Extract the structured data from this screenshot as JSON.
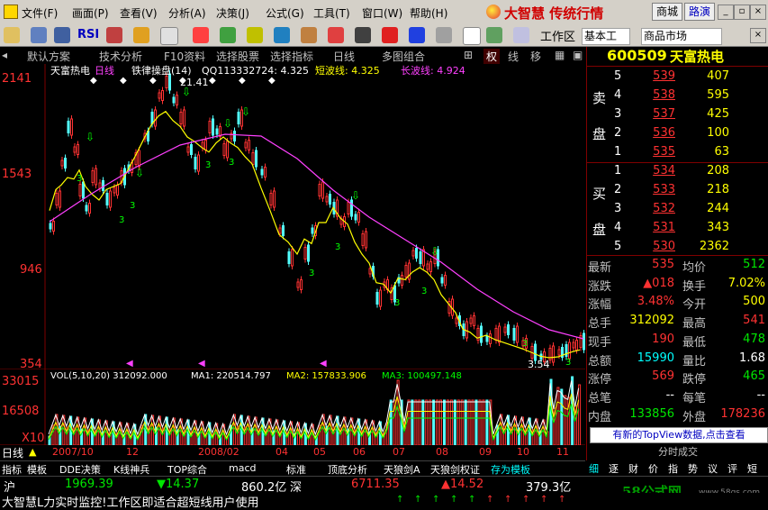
{
  "menu": {
    "items": [
      "文件(F)",
      "画面(P)",
      "查看(V)",
      "分析(A)",
      "决策(J)",
      "公式(G)",
      "工具(T)",
      "窗口(W)",
      "帮助(H)"
    ],
    "brand": "大智慧 传统行情",
    "btn_market": "商城",
    "btn_road": "路演"
  },
  "toolbar": {
    "rsi": "RSI",
    "workspace": "工作区",
    "basic": "基本工",
    "market": "商品市场"
  },
  "tabs": [
    "默认方案",
    "技术分析",
    "F10资料",
    "选择股票",
    "选择指标",
    "日线",
    "多图组合",
    "权",
    "线",
    "移"
  ],
  "chart": {
    "header_name": "天富热电",
    "header_period": "日线",
    "header_indicator": "铁律操盘(14)",
    "header_qq": "QQ113332724: 4.325",
    "header_short": "短波线: 4.325",
    "header_long": "长波线: 4.924",
    "peak_label": "21.41",
    "trough_label": "3.54",
    "y_labels": [
      "2141",
      "1543",
      "946",
      "354"
    ],
    "vol_header": "VOL(5,10,20) 312092.000",
    "ma1": "MA1: 220514.797",
    "ma2": "MA2: 157833.906",
    "ma3": "MA3: 100497.148",
    "vol_labels": [
      "33015",
      "16508",
      "X10"
    ],
    "x_labels": [
      "2007/10",
      "12",
      "2008/02",
      "04",
      "05",
      "06",
      "07",
      "08",
      "09",
      "10",
      "11"
    ],
    "period_btn": "日线"
  },
  "quote": {
    "code": "600509",
    "name": "天富热电",
    "sell_label": [
      "卖",
      "盘"
    ],
    "buy_label": [
      "买",
      "盘"
    ],
    "sell": [
      {
        "lvl": "5",
        "price": "539",
        "vol": "407"
      },
      {
        "lvl": "4",
        "price": "538",
        "vol": "595"
      },
      {
        "lvl": "3",
        "price": "537",
        "vol": "425"
      },
      {
        "lvl": "2",
        "price": "536",
        "vol": "100"
      },
      {
        "lvl": "1",
        "price": "535",
        "vol": "63"
      }
    ],
    "buy": [
      {
        "lvl": "1",
        "price": "534",
        "vol": "208"
      },
      {
        "lvl": "2",
        "price": "533",
        "vol": "218"
      },
      {
        "lvl": "3",
        "price": "532",
        "vol": "244"
      },
      {
        "lvl": "4",
        "price": "531",
        "vol": "343"
      },
      {
        "lvl": "5",
        "price": "530",
        "vol": "2362"
      }
    ],
    "stats": [
      {
        "l1": "最新",
        "v1": "535",
        "c1": "red",
        "l2": "均价",
        "v2": "512",
        "c2": "green"
      },
      {
        "l1": "涨跌",
        "v1": "▲018",
        "c1": "red",
        "l2": "换手",
        "v2": "7.02%",
        "c2": "yellow"
      },
      {
        "l1": "涨幅",
        "v1": "3.48%",
        "c1": "red",
        "l2": "今开",
        "v2": "500",
        "c2": "yellow"
      },
      {
        "l1": "总手",
        "v1": "312092",
        "c1": "yellow",
        "l2": "最高",
        "v2": "541",
        "c2": "red"
      },
      {
        "l1": "现手",
        "v1": "190",
        "c1": "red",
        "l2": "最低",
        "v2": "478",
        "c2": "green"
      },
      {
        "l1": "总额",
        "v1": "15990",
        "c1": "cyan",
        "l2": "量比",
        "v2": "1.68",
        "c2": "white"
      },
      {
        "l1": "涨停",
        "v1": "569",
        "c1": "red",
        "l2": "跌停",
        "v2": "465",
        "c2": "green"
      },
      {
        "l1": "总笔",
        "v1": "--",
        "c1": "white",
        "l2": "每笔",
        "v2": "--",
        "c2": "white"
      },
      {
        "l1": "内盘",
        "v1": "133856",
        "c1": "green",
        "l2": "外盘",
        "v2": "178236",
        "c2": "red"
      }
    ],
    "notice": "有新的TopView数据,点击查看",
    "ticks_title": "分时成交",
    "rtabs": [
      "细",
      "逐",
      "财",
      "价",
      "指",
      "势",
      "议",
      "评",
      "短"
    ]
  },
  "bottom_tabs": [
    "指标",
    "模板",
    "DDE决策",
    "K线神兵",
    "TOP综合",
    "macd",
    "标准",
    "顶底分析",
    "天狼剑A",
    "天狼剑权证",
    "存为模板"
  ],
  "status": {
    "market1": "沪",
    "index1": "1969.39",
    "chg1": "▼14.37",
    "amt1": "860.2亿",
    "market2": "深",
    "index2": "6711.35",
    "chg2": "▲14.52",
    "amt2": "379.3亿",
    "ticker": "大智慧L力实时监控!工作区即适合超短线用户使用",
    "watermark": "58公式网",
    "watermark_url": "www.58gs.com"
  },
  "chart_data": {
    "type": "candlestick",
    "y_range": [
      3.54,
      21.41
    ],
    "price_ticks": [
      21.41,
      15.43,
      9.46,
      3.54
    ]
  }
}
